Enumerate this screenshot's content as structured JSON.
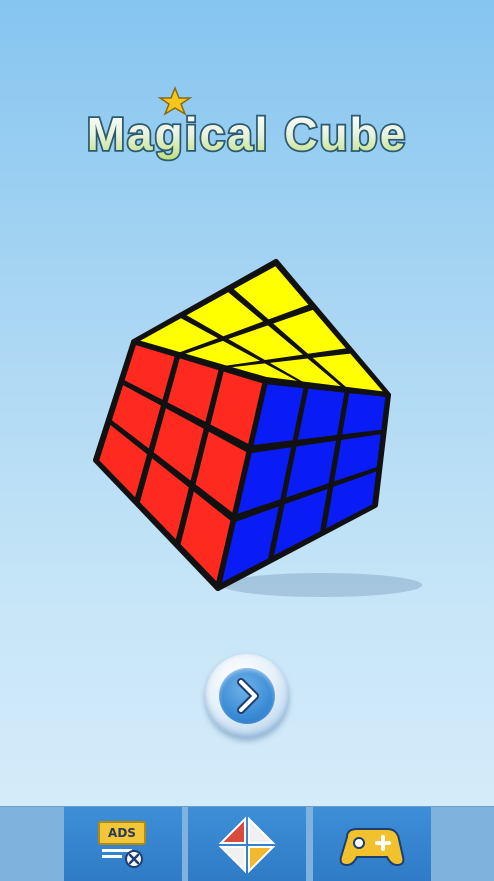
{
  "app": {
    "title": "Magical Cube"
  },
  "cube": {
    "faces": {
      "top": "#ffff00",
      "left": "#ff2a1f",
      "right": "#0a1cf5"
    },
    "grid": "3x3"
  },
  "controls": {
    "play_icon": "chevron-right-icon"
  },
  "bottom_bar": {
    "remove_ads": {
      "label": "ADS",
      "icon": "remove-ads-icon"
    },
    "puzzles": {
      "icon": "puzzle-pieces-icon"
    },
    "more_games": {
      "icon": "gamepad-plus-icon"
    }
  },
  "colors": {
    "background_top": "#86c5f0",
    "background_bottom": "#d9eefa",
    "bar": "#2f7bc6",
    "accent_star": "#f7c61d"
  }
}
